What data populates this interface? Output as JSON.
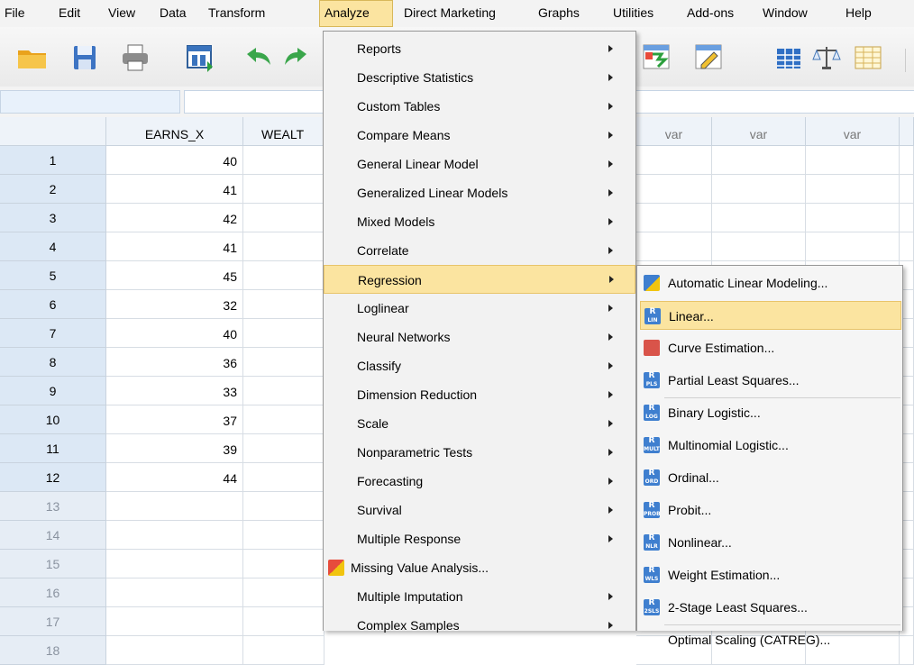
{
  "menubar": {
    "items": [
      {
        "label": "File"
      },
      {
        "label": "Edit"
      },
      {
        "label": "View"
      },
      {
        "label": "Data"
      },
      {
        "label": "Transform"
      },
      {
        "label": "Analyze"
      },
      {
        "label": "Direct Marketing"
      },
      {
        "label": "Graphs"
      },
      {
        "label": "Utilities"
      },
      {
        "label": "Add-ons"
      },
      {
        "label": "Window"
      },
      {
        "label": "Help"
      }
    ]
  },
  "toolbar": {
    "icons": [
      "open-folder-icon",
      "save-icon",
      "print-icon",
      "dialog-recall-icon",
      "undo-icon",
      "redo-icon",
      "goto-case-icon",
      "variables-icon",
      "find-icon",
      "split-file-icon",
      "weight-cases-icon",
      "select-cases-icon"
    ]
  },
  "grid": {
    "columns": [
      "EARNS_X",
      "WEALT",
      "var",
      "var",
      "var"
    ],
    "rows": [
      {
        "n": "1",
        "earns": "40"
      },
      {
        "n": "2",
        "earns": "41"
      },
      {
        "n": "3",
        "earns": "42"
      },
      {
        "n": "4",
        "earns": "41"
      },
      {
        "n": "5",
        "earns": "45"
      },
      {
        "n": "6",
        "earns": "32"
      },
      {
        "n": "7",
        "earns": "40"
      },
      {
        "n": "8",
        "earns": "36"
      },
      {
        "n": "9",
        "earns": "33"
      },
      {
        "n": "10",
        "earns": "37"
      },
      {
        "n": "11",
        "earns": "39"
      },
      {
        "n": "12",
        "earns": "44"
      },
      {
        "n": "13",
        "earns": ""
      },
      {
        "n": "14",
        "earns": ""
      },
      {
        "n": "15",
        "earns": ""
      },
      {
        "n": "16",
        "earns": ""
      },
      {
        "n": "17",
        "earns": ""
      },
      {
        "n": "18",
        "earns": ""
      }
    ]
  },
  "analyze_menu": {
    "items": [
      {
        "label": "Reports",
        "submenu": true
      },
      {
        "label": "Descriptive Statistics",
        "submenu": true
      },
      {
        "label": "Custom Tables",
        "submenu": true
      },
      {
        "label": "Compare Means",
        "submenu": true
      },
      {
        "label": "General Linear Model",
        "submenu": true
      },
      {
        "label": "Generalized Linear Models",
        "submenu": true
      },
      {
        "label": "Mixed Models",
        "submenu": true
      },
      {
        "label": "Correlate",
        "submenu": true
      },
      {
        "label": "Regression",
        "submenu": true,
        "highlighted": true
      },
      {
        "label": "Loglinear",
        "submenu": true
      },
      {
        "label": "Neural Networks",
        "submenu": true
      },
      {
        "label": "Classify",
        "submenu": true
      },
      {
        "label": "Dimension Reduction",
        "submenu": true
      },
      {
        "label": "Scale",
        "submenu": true
      },
      {
        "label": "Nonparametric Tests",
        "submenu": true
      },
      {
        "label": "Forecasting",
        "submenu": true
      },
      {
        "label": "Survival",
        "submenu": true
      },
      {
        "label": "Multiple Response",
        "submenu": true
      },
      {
        "label": "Missing Value Analysis...",
        "submenu": false,
        "icon": "missing-value-icon"
      },
      {
        "label": "Multiple Imputation",
        "submenu": true
      },
      {
        "label": "Complex Samples",
        "submenu": true
      }
    ]
  },
  "regression_menu": {
    "items": [
      {
        "label": "Automatic Linear Modeling...",
        "icon": "auto-linear-icon",
        "tag": ""
      },
      {
        "label": "Linear...",
        "icon": "linear-icon",
        "tag": "LIN",
        "highlighted": true
      },
      {
        "label": "Curve Estimation...",
        "icon": "curve-icon",
        "tag": ""
      },
      {
        "label": "Partial Least Squares...",
        "icon": "pls-icon",
        "tag": "PLS"
      },
      {
        "label": "Binary Logistic...",
        "icon": "logistic-icon",
        "tag": "LOG"
      },
      {
        "label": "Multinomial Logistic...",
        "icon": "multinomial-icon",
        "tag": "MULT"
      },
      {
        "label": "Ordinal...",
        "icon": "ordinal-icon",
        "tag": "ORD"
      },
      {
        "label": "Probit...",
        "icon": "probit-icon",
        "tag": "PROB"
      },
      {
        "label": "Nonlinear...",
        "icon": "nonlinear-icon",
        "tag": "NLR"
      },
      {
        "label": "Weight Estimation...",
        "icon": "weight-icon",
        "tag": "WLS"
      },
      {
        "label": "2-Stage Least Squares...",
        "icon": "2sls-icon",
        "tag": "2SLS"
      },
      {
        "label": "Optimal Scaling (CATREG)...",
        "icon": "",
        "tag": ""
      }
    ]
  },
  "colors": {
    "highlight": "#fbe4a0",
    "menu_bg": "#f2f2f2",
    "rowheader": "#dce8f5",
    "icon_blue": "#3f7fcf"
  }
}
